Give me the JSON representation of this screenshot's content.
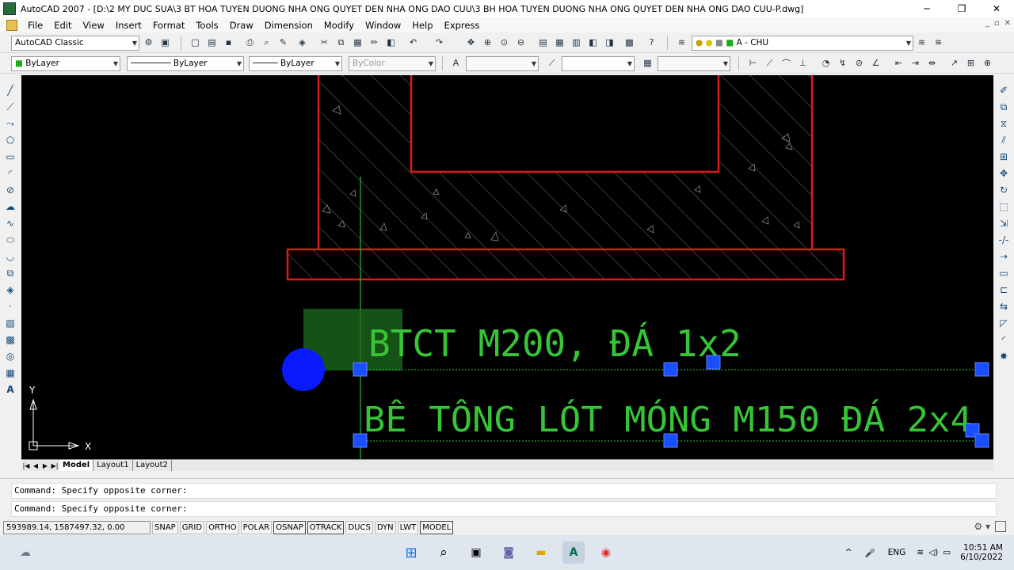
{
  "window": {
    "title": "AutoCAD 2007 - [D:\\2 MY DUC SUA\\3 BT HOA TUYEN DUONG  NHA ONG QUYET DEN NHA ONG  DAO CUU\\3 BH HOA TUYEN DUONG NHA ONG QUYET DEN NHA ONG  DAO CUU-P.dwg]",
    "minimize": "─",
    "restore": "❐",
    "close": "✕"
  },
  "menu": {
    "items": [
      "File",
      "Edit",
      "View",
      "Insert",
      "Format",
      "Tools",
      "Draw",
      "Dimension",
      "Modify",
      "Window",
      "Help",
      "Express"
    ],
    "inner_controls": [
      "_",
      "▫",
      "✕"
    ]
  },
  "toolbar1": {
    "workspace": "AutoCAD Classic",
    "layer": "A - CHU"
  },
  "toolbar2": {
    "color": "ByLayer",
    "linetype": "ByLayer",
    "lineweight": "ByLayer",
    "plotstyle": "ByColor"
  },
  "canvas": {
    "text1": "BTCT M200, ĐÁ 1x2",
    "text2": "BÊ TÔNG LÓT MÓNG M150 ĐÁ 2x4",
    "ucs_x": "X",
    "ucs_y": "Y",
    "colors": {
      "background": "#000000",
      "outline": "#e01818",
      "text": "#36c536",
      "grip": "#1a4fff"
    }
  },
  "tabs": {
    "items": [
      "Model",
      "Layout1",
      "Layout2"
    ]
  },
  "command": {
    "line1": "Command: Specify opposite corner:",
    "line2": "Command: Specify opposite corner:"
  },
  "status": {
    "coords": "593989.14, 1587497.32, 0.00",
    "buttons": [
      "SNAP",
      "GRID",
      "ORTHO",
      "POLAR",
      "OSNAP",
      "OTRACK",
      "DUCS",
      "DYN",
      "LWT",
      "MODEL"
    ]
  },
  "taskbar": {
    "lang": "ENG",
    "time": "10:51 AM",
    "date": "6/10/2022"
  }
}
